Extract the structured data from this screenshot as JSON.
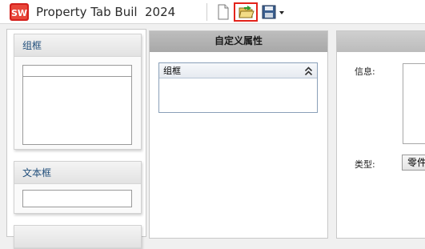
{
  "title_bar": {
    "app_title": "Property Tab Builder",
    "version": "2024",
    "icons": [
      "solidworks-logo",
      "new-file-icon",
      "open-file-icon",
      "save-icon",
      "dropdown-arrow-icon"
    ]
  },
  "controls_panel": {
    "items": [
      {
        "label": "组框"
      },
      {
        "label": "文本框"
      }
    ]
  },
  "custom_properties": {
    "header": "自定义属性",
    "group_label": "组框"
  },
  "properties_panel": {
    "info_label": "信息:",
    "type_label": "类型:",
    "type_value": "零件"
  },
  "colors": {
    "highlight": "#e3231b",
    "header_text": "#1f4d7a"
  }
}
